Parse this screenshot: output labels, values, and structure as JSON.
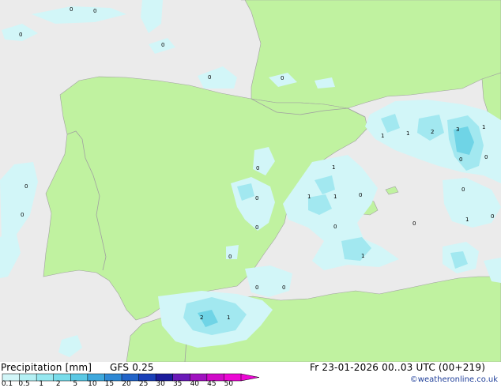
{
  "map": {
    "colors": {
      "sea": "#ebebeb",
      "land": "#c0f2a0",
      "border": "#a0a0a0",
      "precip_light": "#d2f6f8",
      "precip_mid": "#a2e8f0",
      "precip_heavy": "#6fd4e6"
    },
    "value_labels": [
      "0",
      "0",
      "0",
      "0",
      "0",
      "0",
      "0",
      "1",
      "1",
      "2",
      "3",
      "1",
      "0",
      "0",
      "0",
      "1",
      "0",
      "1",
      "1",
      "0",
      "0",
      "0",
      "0",
      "0",
      "1",
      "1",
      "0",
      "0",
      "0",
      "2",
      "1",
      "0",
      "0"
    ]
  },
  "footer": {
    "title": "Precipitation [mm]",
    "model": "GFS 0.25",
    "datetime": "Fr 23-01-2026 00..03 UTC (00+219)",
    "credit": "©weatheronline.co.uk"
  },
  "legend": {
    "ticks": [
      "0.1",
      "0.5",
      "1",
      "2",
      "5",
      "10",
      "15",
      "20",
      "25",
      "30",
      "35",
      "40",
      "45",
      "50"
    ],
    "colors": [
      "#d2f6f8",
      "#b4f0f4",
      "#96e8f0",
      "#78dcea",
      "#5ac8e4",
      "#3ea8dc",
      "#2e88d4",
      "#2264c8",
      "#1a40b8",
      "#1c1c9c",
      "#6a1ab8",
      "#a012c0",
      "#d00ac8",
      "#ec08d4"
    ]
  }
}
